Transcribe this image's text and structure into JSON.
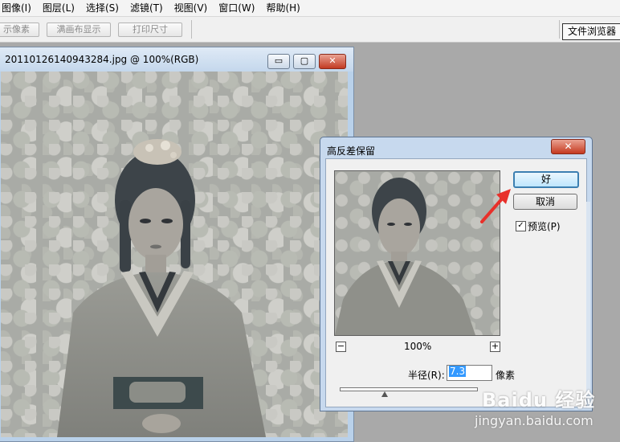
{
  "menubar": {
    "items": [
      "图像(I)",
      "图层(L)",
      "选择(S)",
      "滤镜(T)",
      "视图(V)",
      "窗口(W)",
      "帮助(H)"
    ]
  },
  "options_bar": {
    "btn_actual_pixels": "示像素",
    "btn_fit_screen": "满画布显示",
    "btn_print_size": "打印尺寸",
    "file_browser_tab": "文件浏览器"
  },
  "document": {
    "title": "20110126140943284.jpg @ 100%(RGB)",
    "minimize_glyph": "▭",
    "maximize_glyph": "▢",
    "close_glyph": "✕"
  },
  "dialog": {
    "title": "高反差保留",
    "close_glyph": "✕",
    "ok_label": "好",
    "cancel_label": "取消",
    "preview_checked": true,
    "preview_label": "预览(P)",
    "zoom_out": "−",
    "zoom_in": "+",
    "zoom_level": "100%",
    "radius_label": "半径(R):",
    "radius_value": "7.3",
    "radius_unit": "像素",
    "slider_fraction": 0.33
  },
  "watermark": {
    "logo": "Baidu 经验",
    "url": "jingyan.baidu.com"
  },
  "colors": {
    "accent_arrow": "#e8302a",
    "selection": "#3399ff"
  }
}
